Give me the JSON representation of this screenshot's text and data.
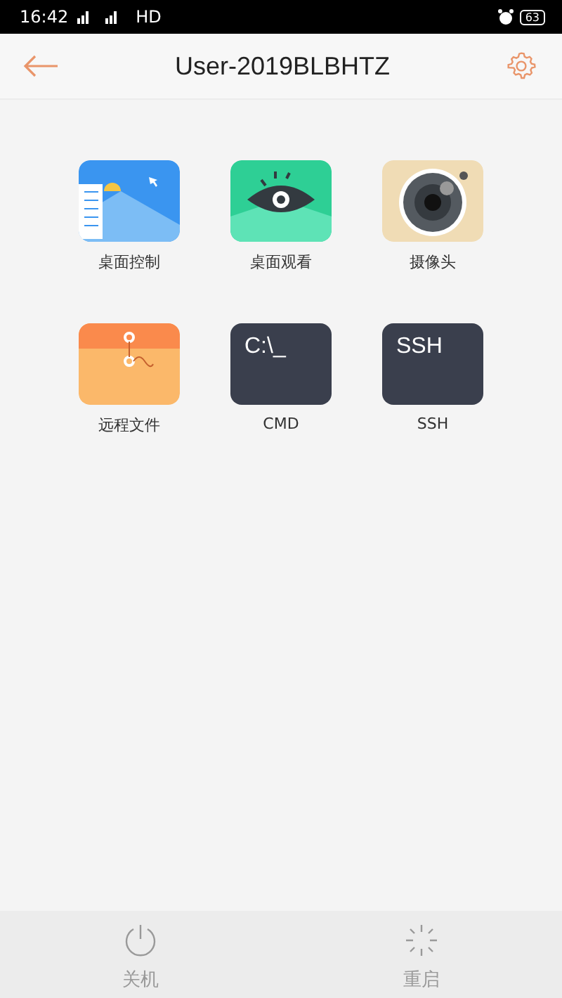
{
  "status_bar": {
    "time": "16:42",
    "network": "HD",
    "battery": "63"
  },
  "header": {
    "title": "User-2019BLBHTZ"
  },
  "apps": [
    {
      "kind": "desktop",
      "label": "桌面控制"
    },
    {
      "kind": "eye",
      "label": "桌面观看"
    },
    {
      "kind": "camera",
      "label": "摄像头"
    },
    {
      "kind": "files",
      "label": "远程文件"
    },
    {
      "kind": "terminal",
      "tile_text": "C:\\_",
      "label": "CMD"
    },
    {
      "kind": "terminal",
      "tile_text": "SSH",
      "label": "SSH"
    }
  ],
  "bottom_bar": [
    {
      "kind": "power",
      "label": "关机"
    },
    {
      "kind": "restart",
      "label": "重启"
    }
  ]
}
